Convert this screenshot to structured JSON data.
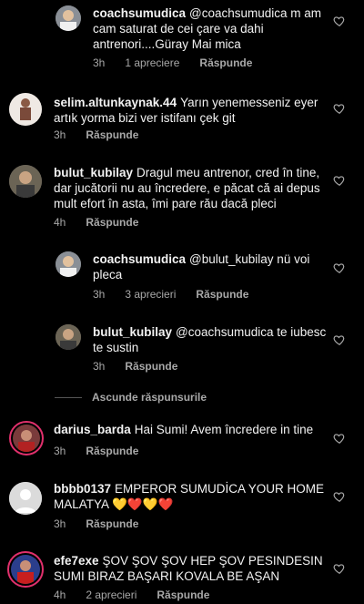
{
  "comments": [
    {
      "username": "coachsumudica",
      "text": "@coachsumudica m am cam saturat de cei çare va dahi antrenori....Güray Mai mica",
      "time": "3h",
      "likes": "1 apreciere",
      "reply": "Răspunde"
    },
    {
      "username": "selim.altunkaynak.44",
      "text": "Yarın yenemesseniz eyer artık yorma bizi ver istifanı çek git",
      "time": "3h",
      "likes": "",
      "reply": "Răspunde"
    },
    {
      "username": "bulut_kubilay",
      "text": "Dragul meu antrenor, cred în tine, dar jucătorii nu au încredere, e păcat că ai depus mult efort în asta, îmi pare rău dacă pleci",
      "time": "4h",
      "likes": "",
      "reply": "Răspunde"
    },
    {
      "username": "coachsumudica",
      "text": "@bulut_kubilay nü voi pleca",
      "time": "3h",
      "likes": "3 aprecieri",
      "reply": "Răspunde"
    },
    {
      "username": "bulut_kubilay",
      "text": "@coachsumudica te iubesc te sustin",
      "time": "3h",
      "likes": "",
      "reply": "Răspunde"
    },
    {
      "username": "darius_barda",
      "text": "Hai Sumi! Avem încredere in tine",
      "time": "3h",
      "likes": "",
      "reply": "Răspunde"
    },
    {
      "username": "bbbb0137",
      "text": "EMPEROR SUMUDİCA YOUR HOME MALATYA 💛❤️💛❤️",
      "time": "3h",
      "likes": "",
      "reply": "Răspunde"
    },
    {
      "username": "efe7exe",
      "text": "ŞOV ŞOV ŞOV HEP ŞOV PESINDESIN SUMI BIRAZ BAŞARI KOVALA BE AŞAN",
      "time": "4h",
      "likes": "2 aprecieri",
      "reply": "Răspunde"
    }
  ],
  "hide_replies": "Ascunde răspunsurile",
  "colors": {
    "background": "#000000",
    "meta": "#a8a8a8",
    "text": "#f2f2f2"
  },
  "icons": {
    "like": "heart-outline-icon"
  }
}
